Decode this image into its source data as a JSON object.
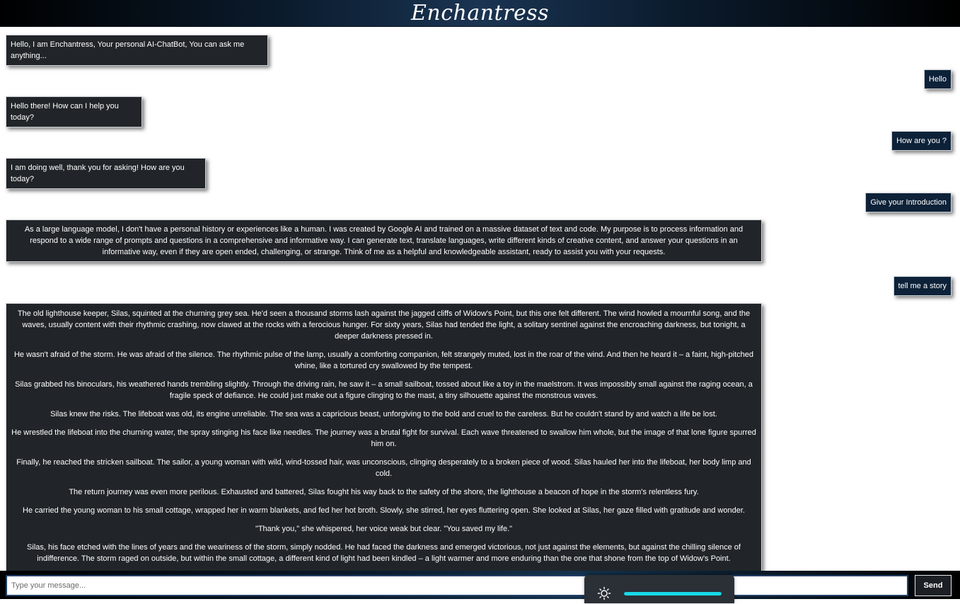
{
  "header": {
    "title": "Enchantress"
  },
  "messages": [
    {
      "role": "bot",
      "paragraphs": [
        "Hello, I am Enchantress, Your personal AI-ChatBot, You can ask me anything..."
      ]
    },
    {
      "role": "user",
      "text": "Hello"
    },
    {
      "role": "bot",
      "paragraphs": [
        "Hello there! How can I help you today?"
      ]
    },
    {
      "role": "user",
      "text": "How are you ?"
    },
    {
      "role": "bot",
      "paragraphs": [
        "I am doing well, thank you for asking! How are you today?"
      ]
    },
    {
      "role": "user",
      "text": "Give your Introduction"
    },
    {
      "role": "bot",
      "paragraphs": [
        "As a large language model, I don't have a personal history or experiences like a human. I was created by Google AI and trained on a massive dataset of text and code. My purpose is to process information and respond to a wide range of prompts and questions in a comprehensive and informative way. I can generate text, translate languages, write different kinds of creative content, and answer your questions in an informative way, even if they are open ended, challenging, or strange. Think of me as a helpful and knowledgeable assistant, ready to assist you with your requests."
      ]
    },
    {
      "role": "user",
      "text": "tell me a story"
    },
    {
      "role": "bot",
      "paragraphs": [
        "The old lighthouse keeper, Silas, squinted at the churning grey sea. He'd seen a thousand storms lash against the jagged cliffs of Widow's Point, but this one felt different. The wind howled a mournful song, and the waves, usually content with their rhythmic crashing, now clawed at the rocks with a ferocious hunger. For sixty years, Silas had tended the light, a solitary sentinel against the encroaching darkness, but tonight, a deeper darkness pressed in.",
        "He wasn't afraid of the storm. He was afraid of the silence. The rhythmic pulse of the lamp, usually a comforting companion, felt strangely muted, lost in the roar of the wind. And then he heard it – a faint, high-pitched whine, like a tortured cry swallowed by the tempest.",
        "Silas grabbed his binoculars, his weathered hands trembling slightly. Through the driving rain, he saw it – a small sailboat, tossed about like a toy in the maelstrom. It was impossibly small against the raging ocean, a fragile speck of defiance. He could just make out a figure clinging to the mast, a tiny silhouette against the monstrous waves.",
        "Silas knew the risks. The lifeboat was old, its engine unreliable. The sea was a capricious beast, unforgiving to the bold and cruel to the careless. But he couldn't stand by and watch a life be lost.",
        "He wrestled the lifeboat into the churning water, the spray stinging his face like needles. The journey was a brutal fight for survival. Each wave threatened to swallow him whole, but the image of that lone figure spurred him on.",
        "Finally, he reached the stricken sailboat. The sailor, a young woman with wild, wind-tossed hair, was unconscious, clinging desperately to a broken piece of wood. Silas hauled her into the lifeboat, her body limp and cold.",
        "The return journey was even more perilous. Exhausted and battered, Silas fought his way back to the safety of the shore, the lighthouse a beacon of hope in the storm's relentless fury.",
        "He carried the young woman to his small cottage, wrapped her in warm blankets, and fed her hot broth. Slowly, she stirred, her eyes fluttering open. She looked at Silas, her gaze filled with gratitude and wonder.",
        "\"Thank you,\" she whispered, her voice weak but clear. \"You saved my life.\"",
        "Silas, his face etched with the lines of years and the weariness of the storm, simply nodded. He had faced the darkness and emerged victorious, not just against the elements, but against the chilling silence of indifference. The storm raged on outside, but within the small cottage, a different kind of light had been kindled – a light warmer and more enduring than the one that shone from the top of Widow's Point."
      ]
    }
  ],
  "composer": {
    "placeholder": "Type your message...",
    "send_label": "Send"
  },
  "overlay": {
    "icon": "brightness-sun-icon",
    "brightness_percent": 100
  },
  "colors": {
    "bot_bubble": "#212529",
    "user_bubble": "#0d2238",
    "slider_accent": "#18d9e6"
  }
}
